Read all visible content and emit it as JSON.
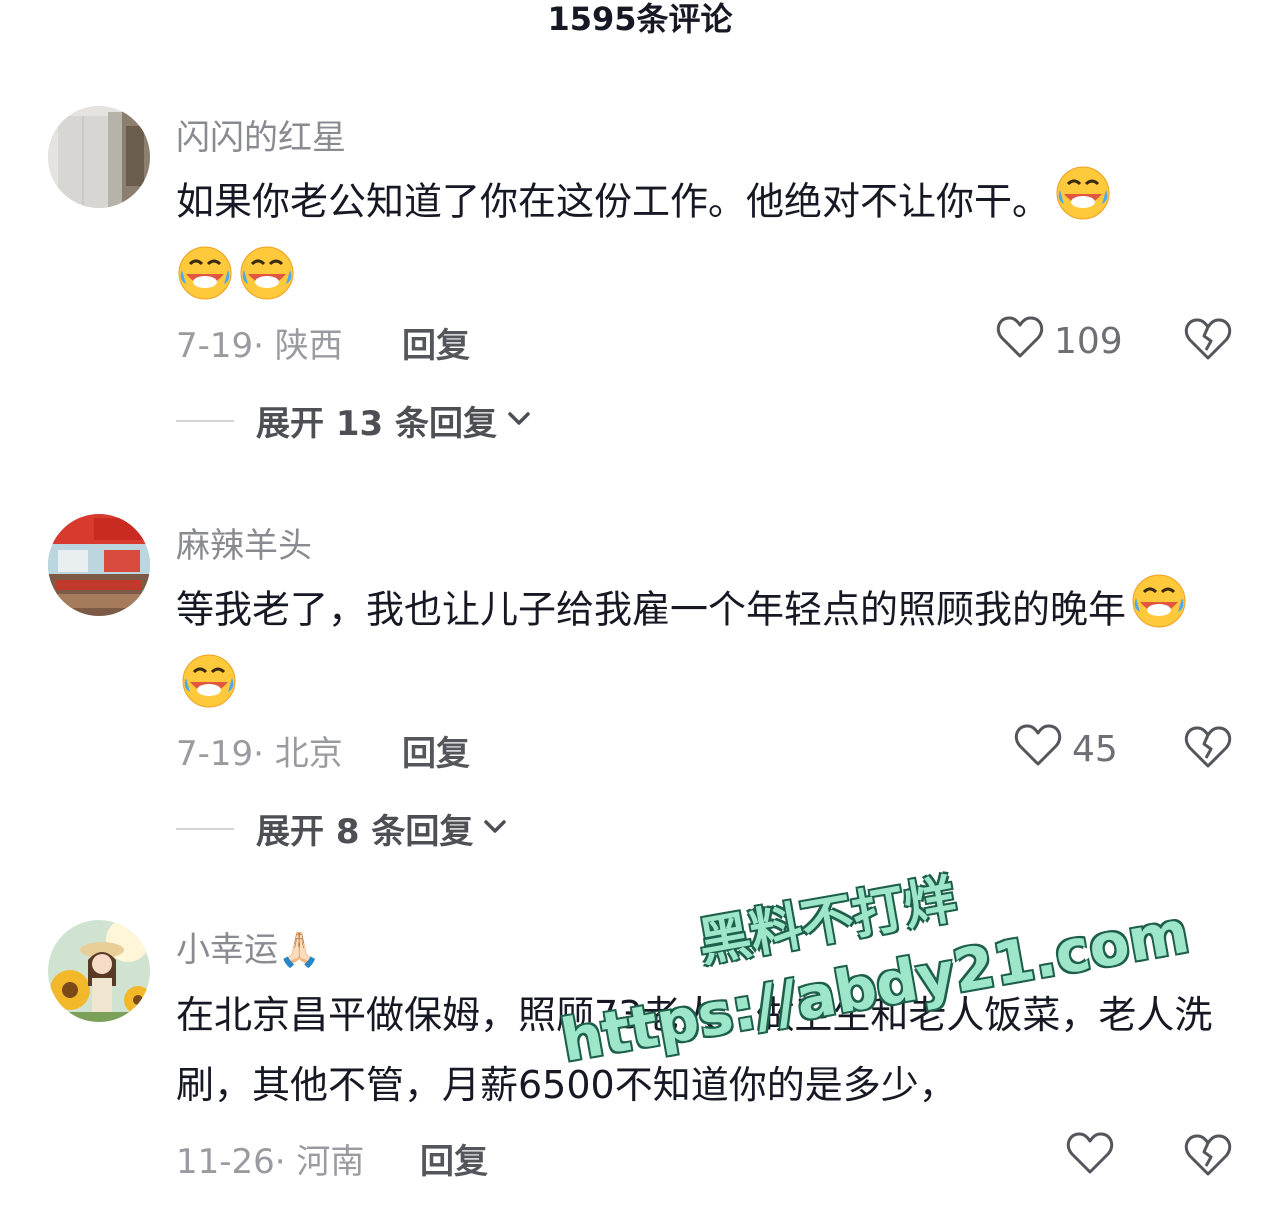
{
  "header": {
    "title": "1595条评论"
  },
  "comments": [
    {
      "username": "闪闪的红星",
      "text": "如果你老公知道了你在这份工作。他绝对不让你干。",
      "date_location": "7-19· 陕西",
      "reply_label": "回复",
      "likes": "109",
      "expand_label": "展开 13 条回复",
      "emoji_names": [
        "rofl-emoji",
        "rofl-emoji",
        "rofl-emoji"
      ]
    },
    {
      "username": "麻辣羊头",
      "text": "等我老了，我也让儿子给我雇一个年轻点的照顾我的晚年",
      "date_location": "7-19· 北京",
      "reply_label": "回复",
      "likes": "45",
      "expand_label": "展开 8 条回复",
      "emoji_names": [
        "rofl-emoji",
        "rofl-emoji"
      ]
    },
    {
      "username": "小幸运",
      "username_emoji": "🙏🏻",
      "text": "在北京昌平做保姆，照顾73老人，做卫生和老人饭菜，老人洗刷，其他不管，月薪6500不知道你的是多少，",
      "date_location": "11-26· 河南",
      "reply_label": "回复",
      "likes": ""
    }
  ],
  "watermark": {
    "line1": "黑料不打烊",
    "line2": "https://abdy21.com"
  },
  "colors": {
    "text": "#161823",
    "muted": "#8a8b91",
    "watermark_fill": "#9ee6c9",
    "watermark_stroke": "#1e5f4b"
  }
}
